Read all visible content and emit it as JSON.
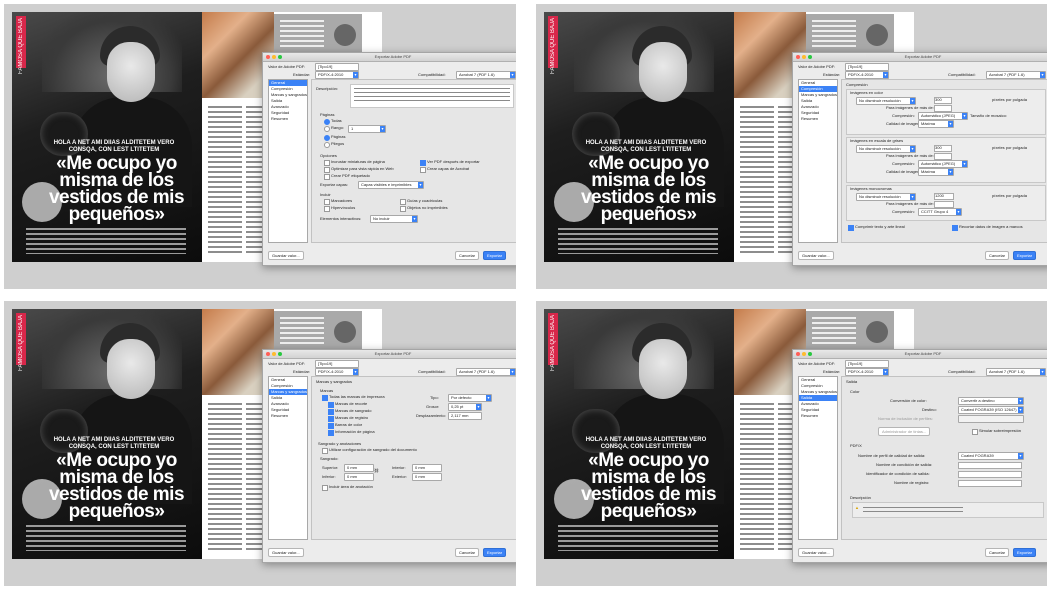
{
  "magazine": {
    "section_tab": "FAMOSA QUE BAJA",
    "kicker_line1": "HOLA A NET AMI DIIAS ALDITETEM VERO",
    "kicker_line2": "CONSQA, CON LEST LTITETEM",
    "headline": "«Me ocupo yo misma de los vestidos de mis pequeños»"
  },
  "dialog": {
    "title_bar": "Exportar Adobe PDF",
    "preset_label": "Valor de Adobe PDF:",
    "preset_value": "[Tipo19]",
    "standard_label": "Estándar:",
    "standard_value": "PDF/X-4:2010",
    "compat_label": "Compatibilidad:",
    "compat_value": "Acrobat 7 (PDF 1.6)",
    "save_preset_button": "Guardar valor...",
    "cancel_button": "Cancelar",
    "export_button": "Exportar",
    "sidebar_items": [
      "General",
      "Compresión",
      "Marcas y sangrados",
      "Salida",
      "Avanzado",
      "Seguridad",
      "Resumen"
    ]
  },
  "panel1": {
    "active_item": 0,
    "description_label": "Descripción:",
    "pages_label": "Páginas",
    "all_label": "Todas",
    "range_label": "Rango:",
    "range_value": "1",
    "pages_opt": "Páginas",
    "spreads_opt": "Pliegos",
    "options_label": "Opciones",
    "opt1": "Incrustar miniaturas de página",
    "opt2": "Optimizar para vista rápida en Web",
    "opt3": "Crear PDF etiquetado",
    "opt4": "Ver PDF después de exportar",
    "opt5": "Crear capas de Acrobat",
    "export_layers_label": "Exportar capas:",
    "export_layers_value": "Capas visibles e imprimibles",
    "include_label": "Incluir",
    "bookmarks": "Marcadores",
    "hyperlinks": "Hipervínculos",
    "visible_guides": "Guías y cuadrículas",
    "non_printing": "Objetos no imprimibles",
    "interactive_label": "Elementos interactivos:",
    "interactive_value": "No incluir"
  },
  "panel2": {
    "active_item": 1,
    "section_title": "Compresión",
    "color_images": "Imágenes en color",
    "gray_images": "Imágenes en escala de grises",
    "mono_images": "Imágenes monocromas",
    "downsample_value": "No disminuir resolución",
    "ppi_300": "300",
    "ppi_1200": "1200",
    "ppi_label": "píxeles por pulgada",
    "above_label": "Para imágenes de más de:",
    "compression_label": "Compresión:",
    "compression_value": "Automático (JPEG)",
    "quality_label": "Calidad de imagen:",
    "quality_value": "Máxima",
    "mono_compression": "CCITT Grupo 4",
    "tile_label": "Tamaño de mosaico:",
    "compress_text": "Comprimir texto y arte lineal",
    "crop_images": "Recortar datos de imagen a marcos"
  },
  "panel3": {
    "active_item": 2,
    "section_title": "Marcas y sangrados",
    "marks_label": "Marcas",
    "all_marks": "Todas las marcas de impresora",
    "crop_marks": "Marcas de recorte",
    "bleed_marks": "Marcas de sangrado",
    "reg_marks": "Marcas de registro",
    "color_bars": "Barras de color",
    "page_info": "Información de página",
    "type_label": "Tipo:",
    "type_value": "Por defecto",
    "weight_label": "Grosor:",
    "weight_value": "0,25 pt",
    "offset_label": "Desplazamiento:",
    "offset_value": "2,117 mm",
    "bleed_section": "Sangrado y anotaciones",
    "use_doc_bleed": "Utilizar configuración de sangrado del documento",
    "bleed_label": "Sangrado:",
    "top_label": "Superior:",
    "bottom_label": "Inferior:",
    "inside_label": "Interior:",
    "outside_label": "Exterior:",
    "bleed_value": "0 mm",
    "slug_label": "Incluir área de anotación"
  },
  "panel4": {
    "active_item": 3,
    "section_title": "Salida",
    "color_label": "Color",
    "conversion_label": "Conversión de color:",
    "conversion_value": "Convertir a destino",
    "destination_label": "Destino:",
    "destination_value": "Coated FOGRA39 (ISO 12647)",
    "profile_policy_label": "Norma de inclusión de perfiles:",
    "ink_manager": "Administrador de tintas...",
    "simulate_overprint": "Simular sobreimpresión",
    "pdfx_label": "PDF/X",
    "output_intent_label": "Nombre de perfil de calidad de salida:",
    "output_intent_value": "Coated FOGRA39",
    "condition_name": "Nombre de condición de salida:",
    "condition_id": "Identificador de condición de salida:",
    "registry_name": "Nombre de registro:",
    "description_label": "Descripción"
  }
}
